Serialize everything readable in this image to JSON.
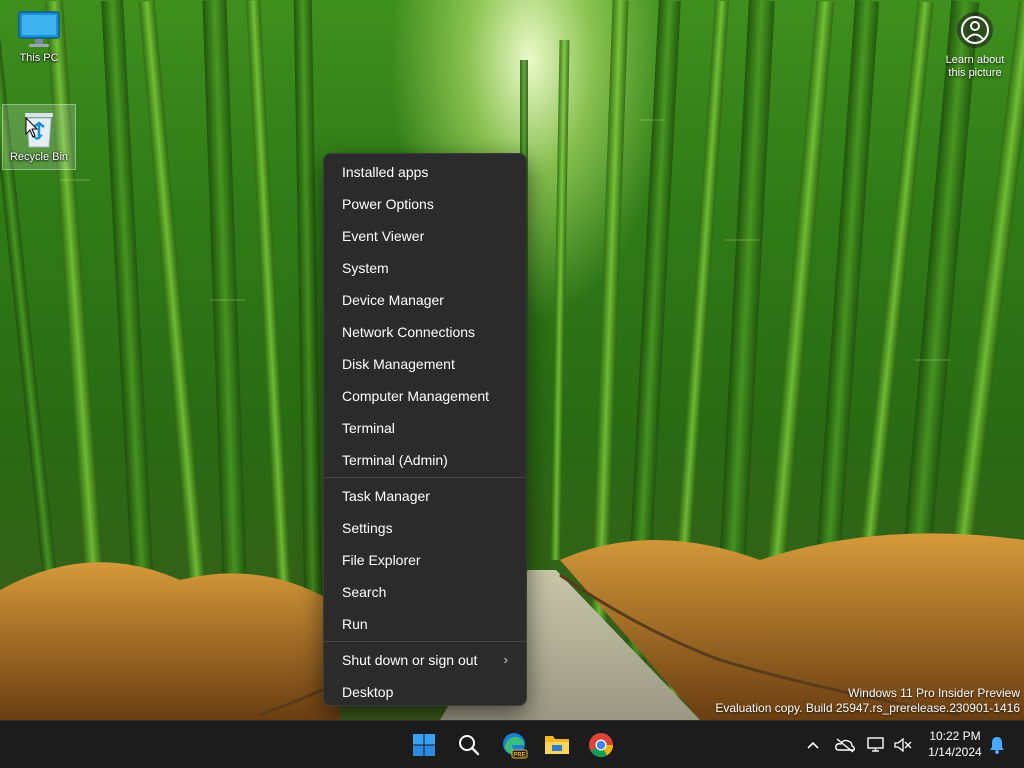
{
  "desktop": {
    "icons": [
      {
        "label": "This PC",
        "icon": "monitor-icon"
      },
      {
        "label": "Recycle Bin",
        "icon": "recycle-bin-icon"
      }
    ],
    "learn_about": "Learn about this picture",
    "watermark": {
      "line1": "Windows 11 Pro Insider Preview",
      "line2": "Evaluation copy. Build 25947.rs_prerelease.230901-1416"
    }
  },
  "menu": {
    "group1": [
      "Installed apps",
      "Power Options",
      "Event Viewer",
      "System",
      "Device Manager",
      "Network Connections",
      "Disk Management",
      "Computer Management",
      "Terminal",
      "Terminal (Admin)"
    ],
    "group2": [
      "Task Manager",
      "Settings",
      "File Explorer",
      "Search",
      "Run"
    ],
    "group3": [
      "Shut down or sign out",
      "Desktop"
    ],
    "submenu_chevron": "›"
  },
  "taskbar": {
    "apps": [
      {
        "name": "Start",
        "icon": "windows-logo-icon"
      },
      {
        "name": "Search",
        "icon": "search-icon"
      },
      {
        "name": "Microsoft Edge Preview",
        "icon": "edge-icon",
        "badge": "PRE"
      },
      {
        "name": "File Explorer",
        "icon": "folder-icon"
      },
      {
        "name": "Google Chrome",
        "icon": "chrome-icon"
      }
    ],
    "tray": {
      "chevron": "^",
      "time": "10:22 PM",
      "date": "1/14/2024"
    }
  },
  "colors": {
    "menu_bg": "#2b2b2b",
    "taskbar_bg": "#1c1c1c",
    "accent": "#0078d4"
  }
}
